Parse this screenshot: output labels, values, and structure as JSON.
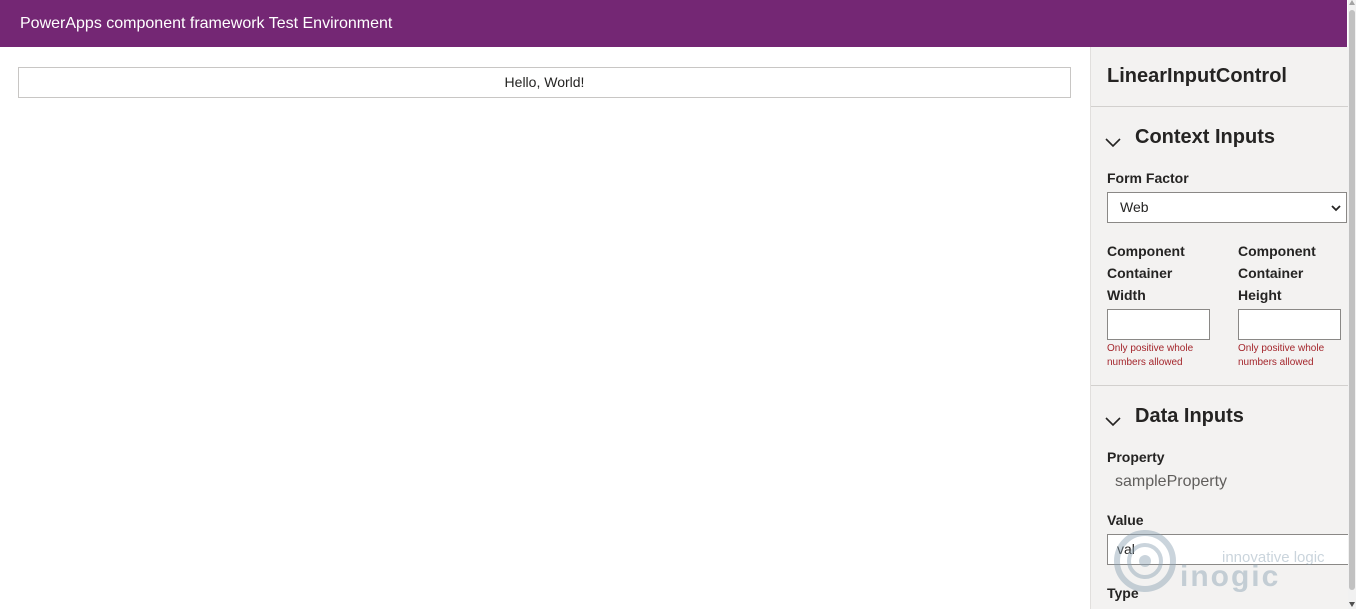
{
  "header": {
    "title": "PowerApps component framework Test Environment"
  },
  "main": {
    "control_text": "Hello, World!"
  },
  "panel": {
    "title": "LinearInputControl",
    "context_inputs": {
      "heading": "Context Inputs",
      "form_factor_label": "Form Factor",
      "form_factor_value": "Web",
      "width_label": [
        "Component",
        "Container",
        "Width"
      ],
      "height_label": [
        "Component",
        "Container",
        "Height"
      ],
      "width_value": "",
      "height_value": "",
      "error_text": [
        "Only positive whole",
        "numbers allowed"
      ]
    },
    "data_inputs": {
      "heading": "Data Inputs",
      "property_label": "Property",
      "property_value": "sampleProperty",
      "value_label": "Value",
      "value_value": "val",
      "type_label": "Type"
    }
  },
  "watermark": {
    "tagline": "innovative logic",
    "brand": "inogic"
  },
  "colors": {
    "header_bg": "#742774",
    "panel_bg": "#f3f2f1",
    "error": "#a4262c"
  }
}
